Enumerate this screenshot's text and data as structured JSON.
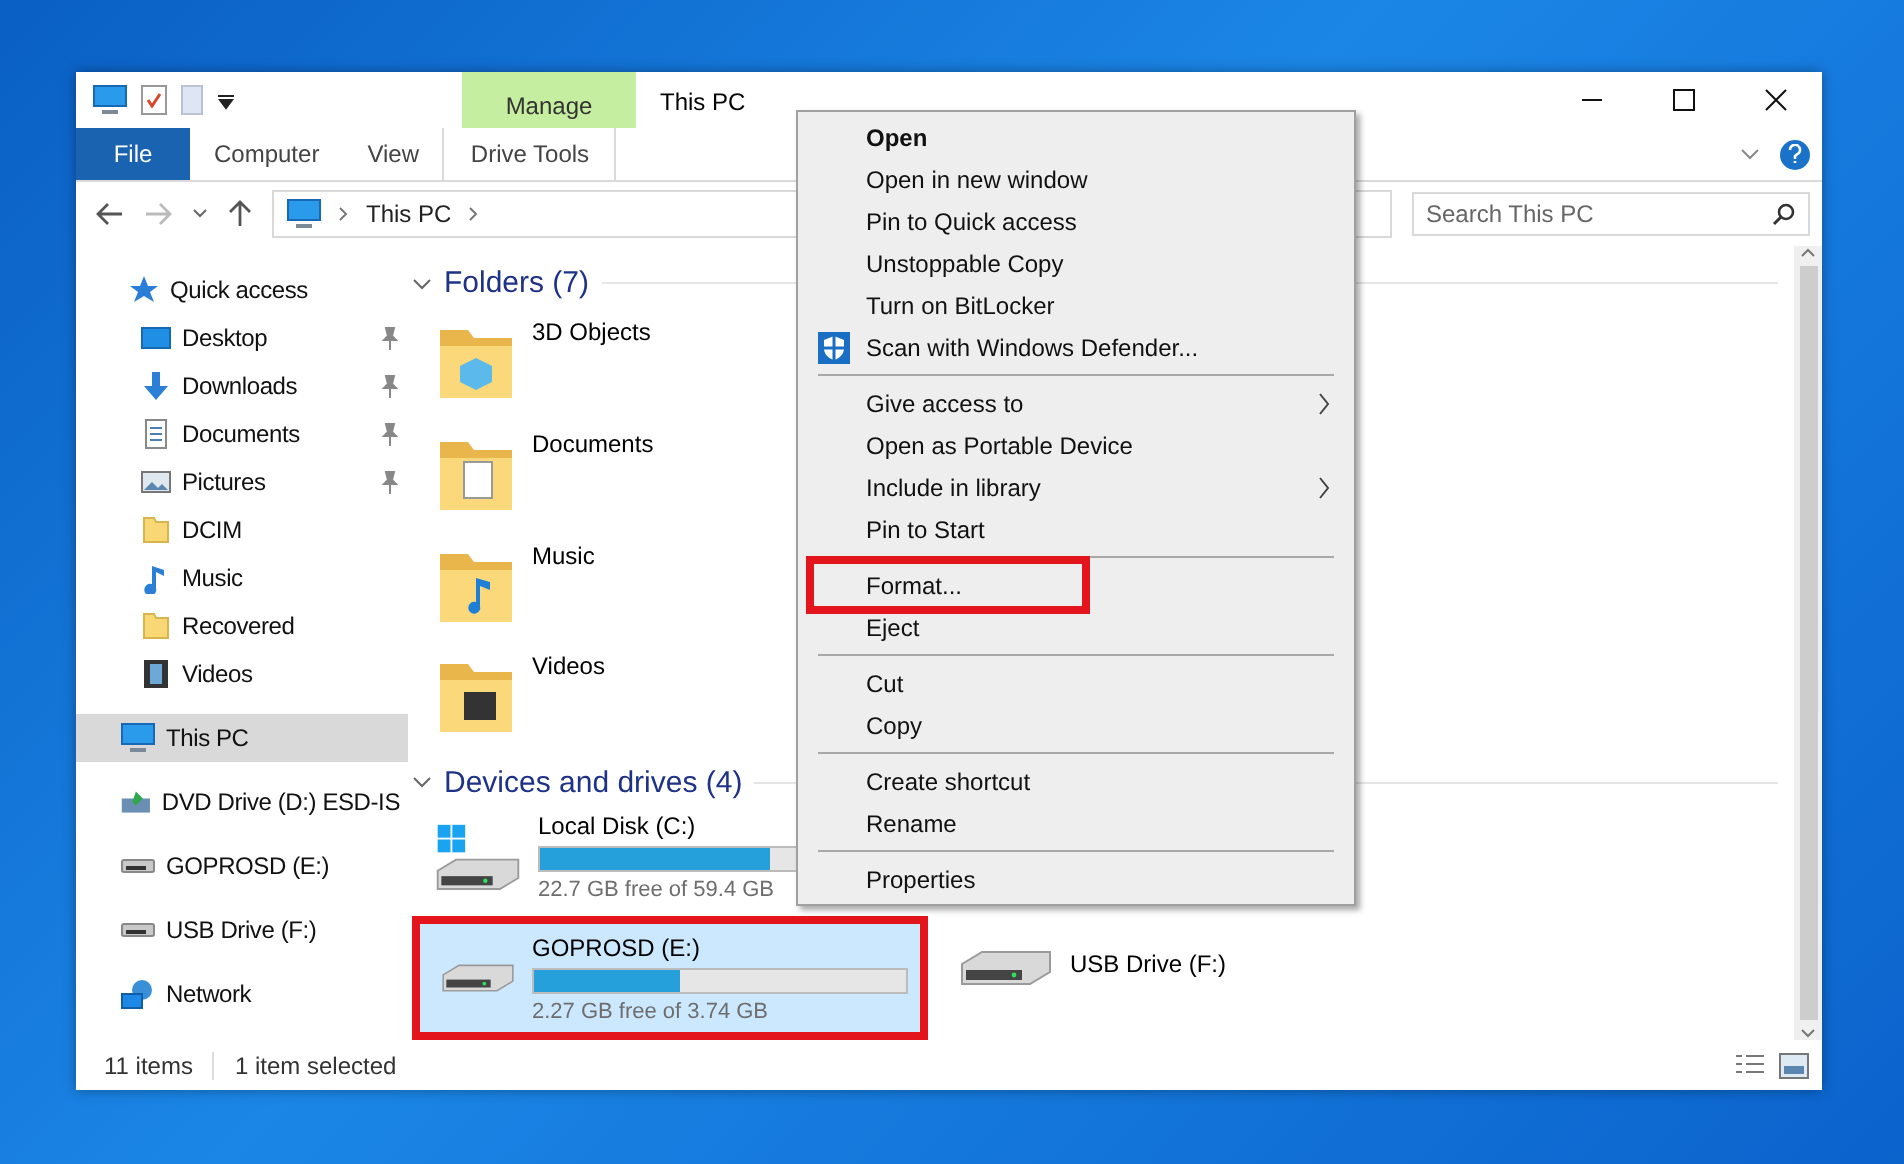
{
  "window": {
    "title": "This PC",
    "context_tab": "Manage"
  },
  "ribbon_tabs": [
    {
      "label": "File",
      "kind": "file",
      "selected": false
    },
    {
      "label": "Computer",
      "kind": "tab",
      "selected": false
    },
    {
      "label": "View",
      "kind": "tab",
      "selected": false
    },
    {
      "label": "Drive Tools",
      "kind": "tab",
      "selected": false
    }
  ],
  "address": {
    "path": [
      "This PC"
    ]
  },
  "search": {
    "placeholder": "Search This PC"
  },
  "sidebar": {
    "items": [
      {
        "label": "Quick access",
        "selected": false,
        "children": [
          {
            "label": "Desktop",
            "pinned": true
          },
          {
            "label": "Downloads",
            "pinned": true
          },
          {
            "label": "Documents",
            "pinned": true
          },
          {
            "label": "Pictures",
            "pinned": true
          },
          {
            "label": "DCIM",
            "pinned": false
          },
          {
            "label": "Music",
            "pinned": false
          },
          {
            "label": "Recovered",
            "pinned": false
          },
          {
            "label": "Videos",
            "pinned": false
          }
        ]
      },
      {
        "label": "This PC",
        "selected": true
      },
      {
        "label": "DVD Drive (D:) ESD-IS",
        "selected": false
      },
      {
        "label": "GOPROSD (E:)",
        "selected": false
      },
      {
        "label": "USB Drive (F:)",
        "selected": false
      },
      {
        "label": "Network",
        "selected": false
      }
    ]
  },
  "folders": {
    "header": "Folders (7)",
    "expanded": true,
    "items": [
      {
        "name": "3D Objects"
      },
      {
        "name": "Documents"
      },
      {
        "name": "Music"
      },
      {
        "name": "Videos"
      }
    ]
  },
  "drives": {
    "header": "Devices and drives (4)",
    "expanded": true,
    "items": [
      {
        "name": "Local Disk (C:)",
        "free": "22.7 GB free of 59.4 GB",
        "level": 0.62,
        "selected": false,
        "highlighted": false
      },
      {
        "name": "GOPROSD (E:)",
        "free": "2.27 GB free of 3.74 GB",
        "level": 0.39,
        "selected": true,
        "highlighted": true
      },
      {
        "name": "USB Drive (F:)",
        "selected": false,
        "highlighted": false
      }
    ]
  },
  "context_menu": {
    "items": [
      {
        "kind": "item",
        "label": "Open",
        "bold": true
      },
      {
        "kind": "item",
        "label": "Open in new window"
      },
      {
        "kind": "item",
        "label": "Pin to Quick access"
      },
      {
        "kind": "item",
        "label": "Unstoppable Copy"
      },
      {
        "kind": "item",
        "label": "Turn on BitLocker"
      },
      {
        "kind": "item",
        "label": "Scan with Windows Defender...",
        "icon": true
      },
      {
        "kind": "separator"
      },
      {
        "kind": "item",
        "label": "Give access to",
        "submenu": true
      },
      {
        "kind": "item",
        "label": "Open as Portable Device"
      },
      {
        "kind": "item",
        "label": "Include in library",
        "submenu": true
      },
      {
        "kind": "item",
        "label": "Pin to Start"
      },
      {
        "kind": "separator"
      },
      {
        "kind": "item",
        "label": "Format...",
        "highlighted": true
      },
      {
        "kind": "item",
        "label": "Eject"
      },
      {
        "kind": "separator"
      },
      {
        "kind": "item",
        "label": "Cut"
      },
      {
        "kind": "item",
        "label": "Copy"
      },
      {
        "kind": "separator"
      },
      {
        "kind": "item",
        "label": "Create shortcut"
      },
      {
        "kind": "item",
        "label": "Rename"
      },
      {
        "kind": "separator"
      },
      {
        "kind": "item",
        "label": "Properties"
      }
    ]
  },
  "status_bar": {
    "count": "11 items",
    "selection": "1 item selected"
  }
}
